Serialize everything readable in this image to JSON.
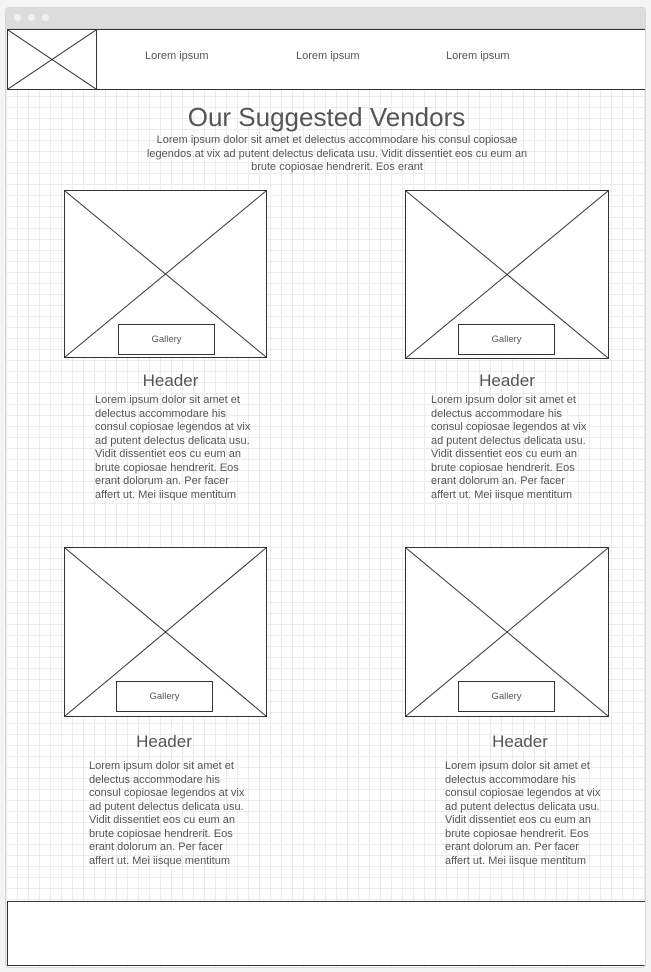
{
  "nav": {
    "links": [
      "Lorem ipsum",
      "Lorem ipsum",
      "Lorem ipsum"
    ]
  },
  "main": {
    "title": "Our Suggested Vendors",
    "intro": "Lorem ipsum dolor sit amet et delectus accommodare his consul copiosae legendos at vix ad putent delectus delicata usu. Vidit dissentiet eos cu eum an brute copiosae hendrerit. Eos erant"
  },
  "cards": [
    {
      "gallery_label": "Gallery",
      "header": "Header",
      "text": "Lorem ipsum dolor sit amet et delectus accommodare his consul copiosae legendos at vix ad putent delectus delicata usu. Vidit dissentiet eos cu eum an brute copiosae hendrerit. Eos erant dolorum an. Per facer affert ut. Mei iisque mentitum"
    },
    {
      "gallery_label": "Gallery",
      "header": "Header",
      "text": "Lorem ipsum dolor sit amet et delectus accommodare his consul copiosae legendos at vix ad putent delectus delicata usu. Vidit dissentiet eos cu eum an brute copiosae hendrerit. Eos erant dolorum an. Per facer affert ut. Mei iisque mentitum"
    },
    {
      "gallery_label": "Gallery",
      "header": "Header",
      "text": "Lorem ipsum dolor sit amet et delectus accommodare his consul copiosae legendos at vix ad putent delectus delicata usu. Vidit dissentiet eos cu eum an brute copiosae hendrerit. Eos erant dolorum an. Per facer affert ut. Mei iisque mentitum"
    },
    {
      "gallery_label": "Gallery",
      "header": "Header",
      "text": "Lorem ipsum dolor sit amet et delectus accommodare his consul copiosae legendos at vix ad putent delectus delicata usu. Vidit dissentiet eos cu eum an brute copiosae hendrerit. Eos erant dolorum an. Per facer affert ut. Mei iisque mentitum"
    }
  ]
}
